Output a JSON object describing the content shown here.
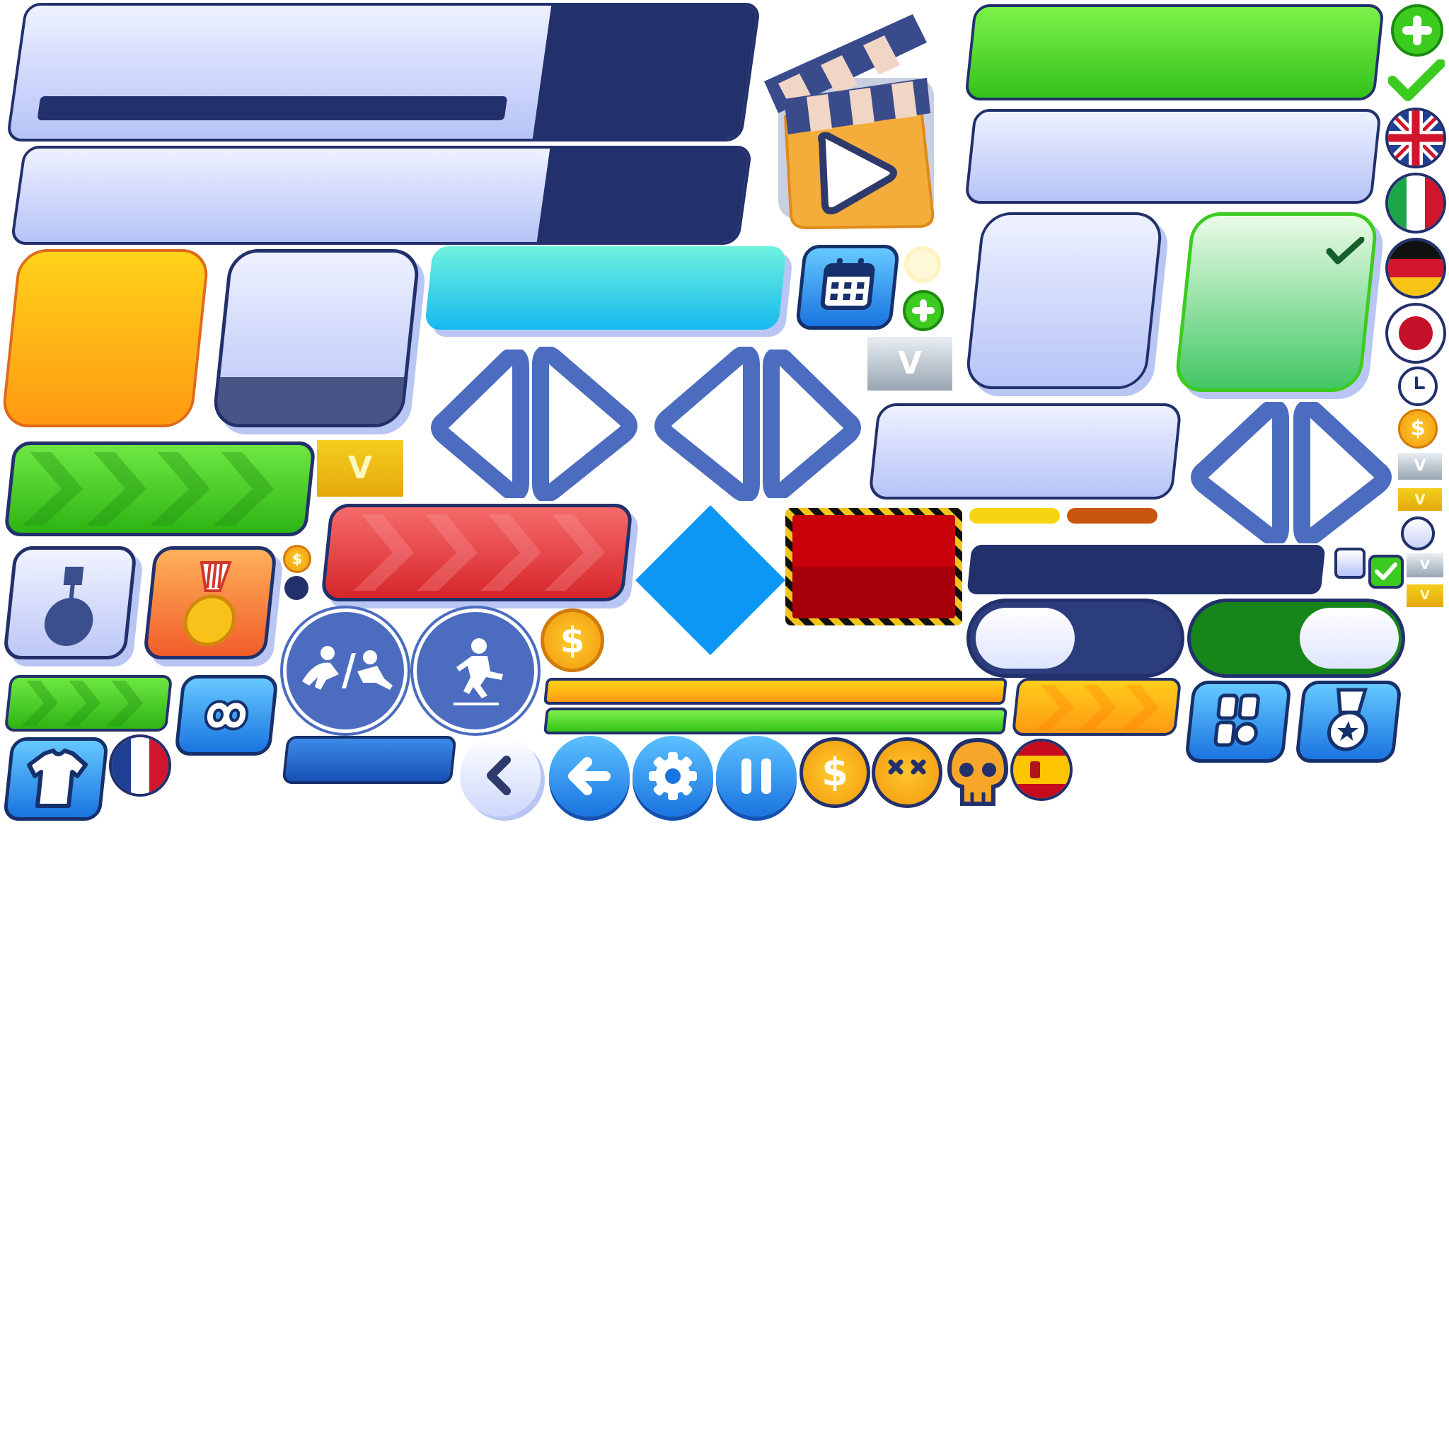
{
  "theme": {
    "navy": "#22306c",
    "lavender": "#b6c3f7",
    "green": "#3ccb1f",
    "cyan": "#22c4ee",
    "orange": "#ffae14",
    "red": "#e43b3b",
    "blue": "#1f7fe0",
    "diamond": "#0b97f3"
  },
  "icons": [
    "clapperboard-play-icon",
    "plus-icon",
    "checkmark-icon",
    "calendar-icon",
    "medal-icon",
    "gold-medal-icon",
    "dollar-coin-icon",
    "crawl-slide-icon",
    "jump-icon",
    "infinity-icon",
    "shirt-icon",
    "back-chevron-icon",
    "back-arrow-icon",
    "gear-icon",
    "pause-icon",
    "dead-face-icon",
    "skull-icon",
    "grid-menu-icon",
    "award-icon",
    "clock-icon",
    "arrow-left-icon",
    "arrow-right-icon"
  ],
  "flags": [
    "uk",
    "italy",
    "germany",
    "japan",
    "france",
    "spain"
  ],
  "badges": {
    "gold_card_label": "V",
    "silver_card_label": "V",
    "coin_label": "$"
  },
  "toggles": [
    {
      "state": "off"
    },
    {
      "state": "on"
    }
  ]
}
